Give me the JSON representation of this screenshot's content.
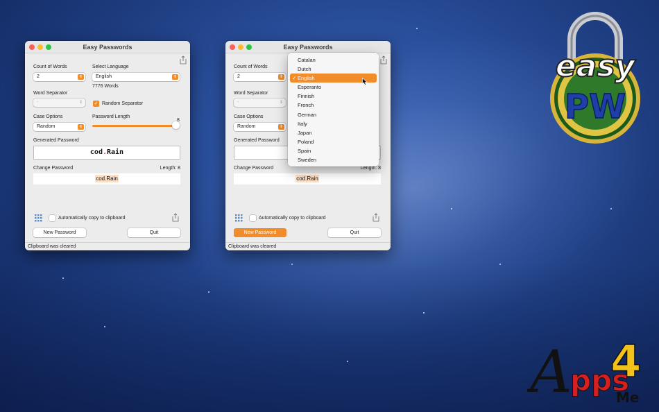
{
  "window1": {
    "title": "Easy Passwords",
    "count_label": "Count of Words",
    "count_value": "2",
    "language_label": "Select Language",
    "language_value": "English",
    "word_count": "7776 Words",
    "separator_label": "Word Separator",
    "separator_value": "-",
    "random_separator_label": "Random Separator",
    "case_label": "Case Options",
    "case_value": "Random",
    "length_label": "Password Length",
    "length_value": "8",
    "length_fraction": 0.95,
    "generated_label": "Generated Password",
    "generated_prefix": "cod",
    "generated_dot": ".",
    "generated_suffix": "Rain",
    "change_label": "Change Password",
    "change_length": "Length: 8",
    "change_value": "cod.Rain",
    "auto_copy_label": "Automatically copy to clipboard",
    "new_password_label": "New Password",
    "quit_label": "Quit",
    "status": "Clipboard was cleared"
  },
  "window2": {
    "title": "Easy Passwords",
    "count_label": "Count of Words",
    "count_value": "2",
    "separator_label": "Word Separator",
    "separator_value": "-",
    "case_label": "Case Options",
    "case_value": "Random",
    "generated_label": "Generated Password",
    "change_label": "Change Password",
    "change_length": "Length: 8",
    "change_value": "cod.Rain",
    "auto_copy_label": "Automatically copy to clipboard",
    "new_password_label": "New Password",
    "quit_label": "Quit",
    "status": "Clipboard was cleared"
  },
  "language_menu": {
    "items": [
      "Catalan",
      "Dutch",
      "English",
      "Esperanto",
      "Finnish",
      "French",
      "German",
      "Italy",
      "Japan",
      "Poland",
      "Spain",
      "Sweden"
    ],
    "selected": "English",
    "check_glyph": "✓"
  },
  "logos": {
    "easy_text": "easy",
    "pw_text": "PW",
    "apps_a": "A",
    "apps_pps": "pps",
    "apps_4": "4",
    "apps_me": "Me"
  },
  "colors": {
    "accent": "#f08c2a"
  }
}
